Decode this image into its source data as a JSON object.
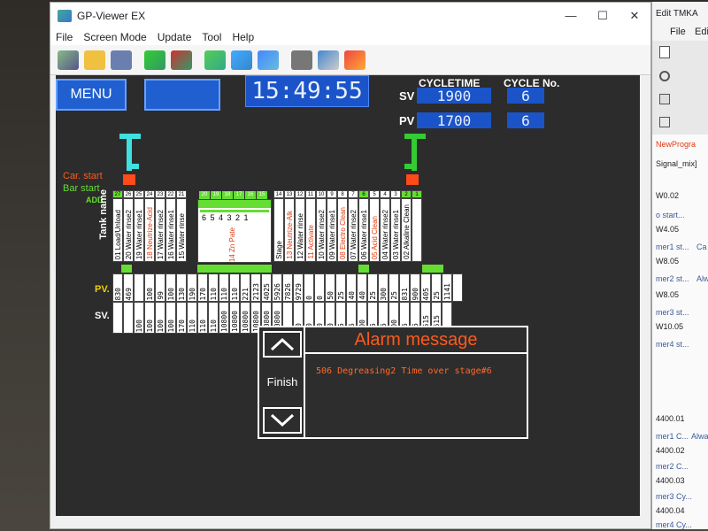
{
  "window": {
    "title": "GP-Viewer EX",
    "controls": [
      "—",
      "☐",
      "✕"
    ]
  },
  "menubar": [
    "File",
    "Screen Mode",
    "Update",
    "Tool",
    "Help"
  ],
  "hmi": {
    "menu_label": "MENU",
    "clock": "15:49:55",
    "cycletime_label": "CYCLETIME",
    "cycleno_label": "CYCLE No.",
    "sv_label": "SV",
    "pv_label": "PV",
    "cycletime_sv": "1900",
    "cycletime_pv": "1700",
    "cycleno_sv": "6",
    "cycleno_pv": "6",
    "car_start": "Car. start",
    "bar_start": "Bar start",
    "add_label": "ADD.",
    "tank_name_label": "Tank name",
    "pv_row_label": "PV.",
    "sv_row_label": "SV.",
    "zn_label": "14 Zn Pate",
    "zn_stage_digits": "6 5 4 3 2 1",
    "tanks": [
      {
        "num": "27",
        "name": "01 Load/Unload",
        "color": "#000",
        "green": true
      },
      {
        "num": "26",
        "name": "20 Water rinse2",
        "color": "#000",
        "green": false
      },
      {
        "num": "25",
        "name": "19 Water rinse1",
        "color": "#000",
        "green": false
      },
      {
        "num": "24",
        "name": "18 Neutrize-Acid",
        "color": "#e03a10",
        "green": false
      },
      {
        "num": "23",
        "name": "17 Water rinse2",
        "color": "#000",
        "green": false
      },
      {
        "num": "22",
        "name": "16 Water rinse1",
        "color": "#000",
        "green": false
      },
      {
        "num": "21",
        "name": "15 Water rinse",
        "color": "#000",
        "green": false
      }
    ],
    "tanks_right": [
      {
        "num": "14",
        "name": "Stage",
        "color": "#000",
        "green": false
      },
      {
        "num": "13",
        "name": "13 Neutrize-Alk",
        "color": "#e03a10",
        "green": false
      },
      {
        "num": "12",
        "name": "12 Water rinse",
        "color": "#000",
        "green": false
      },
      {
        "num": "11",
        "name": "11 Activate",
        "color": "#e03a10",
        "green": false
      },
      {
        "num": "10",
        "name": "10 Water rinse2",
        "color": "#000",
        "green": false
      },
      {
        "num": "9",
        "name": "09 Water rinse1",
        "color": "#000",
        "green": false
      },
      {
        "num": "8",
        "name": "08 Electro Clean",
        "color": "#e03a10",
        "green": false
      },
      {
        "num": "7",
        "name": "07 Water rinse2",
        "color": "#000",
        "green": false
      },
      {
        "num": "6",
        "name": "06 Water rinse1",
        "color": "#000",
        "green": true
      },
      {
        "num": "5",
        "name": "05 Acid Clean",
        "color": "#e03a10",
        "green": false
      },
      {
        "num": "4",
        "name": "04 Water rinse2",
        "color": "#000",
        "green": false
      },
      {
        "num": "3",
        "name": "03 Water rinse1",
        "color": "#000",
        "green": false
      },
      {
        "num": "2",
        "name": "02 Alkaline Clean",
        "color": "#000",
        "green": true
      },
      {
        "num": "1",
        "name": "",
        "color": "#000",
        "green": true
      }
    ],
    "zn_nums": [
      "20",
      "19",
      "18",
      "17",
      "16",
      "15"
    ],
    "pv_values": [
      "830",
      "469",
      "",
      "100",
      "99",
      "100",
      "130",
      "190",
      "170",
      "110",
      "110",
      "110",
      "221",
      "2123",
      "4025",
      "5926",
      "7826",
      "9729",
      "0",
      "0",
      "50",
      "25",
      "40",
      "40",
      "25",
      "300",
      "25",
      "831",
      "900",
      "405",
      "25",
      "1141",
      ""
    ],
    "sv_values": [
      "",
      "",
      "100",
      "100",
      "100",
      "100",
      "170",
      "110",
      "110",
      "110",
      "10800",
      "10800",
      "10800",
      "10800",
      "10800",
      "10800",
      "",
      "50",
      "50",
      "30",
      "30",
      "25",
      "25",
      "300",
      "25",
      "25",
      "900",
      "25",
      "25",
      "1615",
      "1615",
      "0"
    ],
    "alarm": {
      "title": "Alarm message",
      "finish": "Finish",
      "message": "506 Degreasing2 Time over stage#6"
    }
  },
  "right_window": {
    "title": "Edit TMKA",
    "menu": [
      "File",
      "Edit"
    ],
    "items": [
      "NewProgra",
      "Signal_mix]",
      "W0.02",
      "o start...",
      "W4.05",
      "mer1 st...",
      "Ca",
      "W8.05",
      "mer2 st...",
      "Alw",
      "W8.05",
      "mer3 st...",
      "W10.05",
      "mer4 st...",
      "4400.01",
      "mer1 C...",
      "Alway",
      "4400.02",
      "mer2 C...",
      "4400.03",
      "mer3 Cy...",
      "4400.04",
      "mer4 Cy..."
    ]
  },
  "colors": {
    "hmi_bg": "#2c2c2c",
    "blue_box": "#1a54c8",
    "cyan_car": "#40e0e0",
    "green_car": "#33cc33",
    "orange_text": "#ff5a1a",
    "green_label": "#66dd33"
  }
}
